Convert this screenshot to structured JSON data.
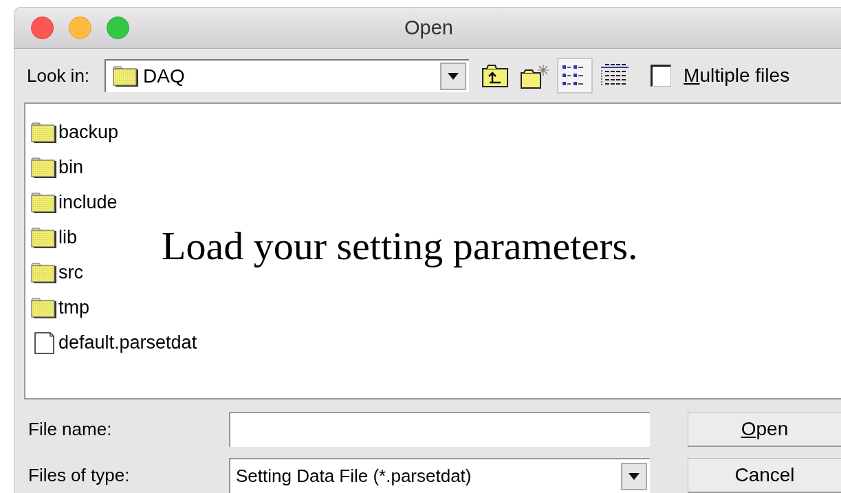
{
  "window": {
    "title": "Open"
  },
  "look_in": {
    "label": "Look in:",
    "value": "DAQ"
  },
  "toolbar": [
    {
      "kind": "up"
    },
    {
      "kind": "new-folder"
    },
    {
      "kind": "list",
      "selected": true
    },
    {
      "kind": "details",
      "selected": false
    }
  ],
  "multiple_files": {
    "underlined": "M",
    "rest": "ultiple files",
    "checked": false
  },
  "files": [
    {
      "kind": "folder",
      "name": "backup"
    },
    {
      "kind": "folder",
      "name": "bin"
    },
    {
      "kind": "folder",
      "name": "include"
    },
    {
      "kind": "folder",
      "name": "lib"
    },
    {
      "kind": "folder",
      "name": "src"
    },
    {
      "kind": "folder",
      "name": "tmp"
    },
    {
      "kind": "file",
      "name": "default.parsetdat"
    }
  ],
  "annotation": "Load your setting parameters.",
  "file_name": {
    "label": "File name:"
  },
  "files_of_type": {
    "label": "Files of type:",
    "value": "Setting Data File (*.parsetdat)"
  },
  "buttons": [
    {
      "underlined": "O",
      "rest": "pen"
    },
    {
      "rest": "Cancel"
    }
  ]
}
